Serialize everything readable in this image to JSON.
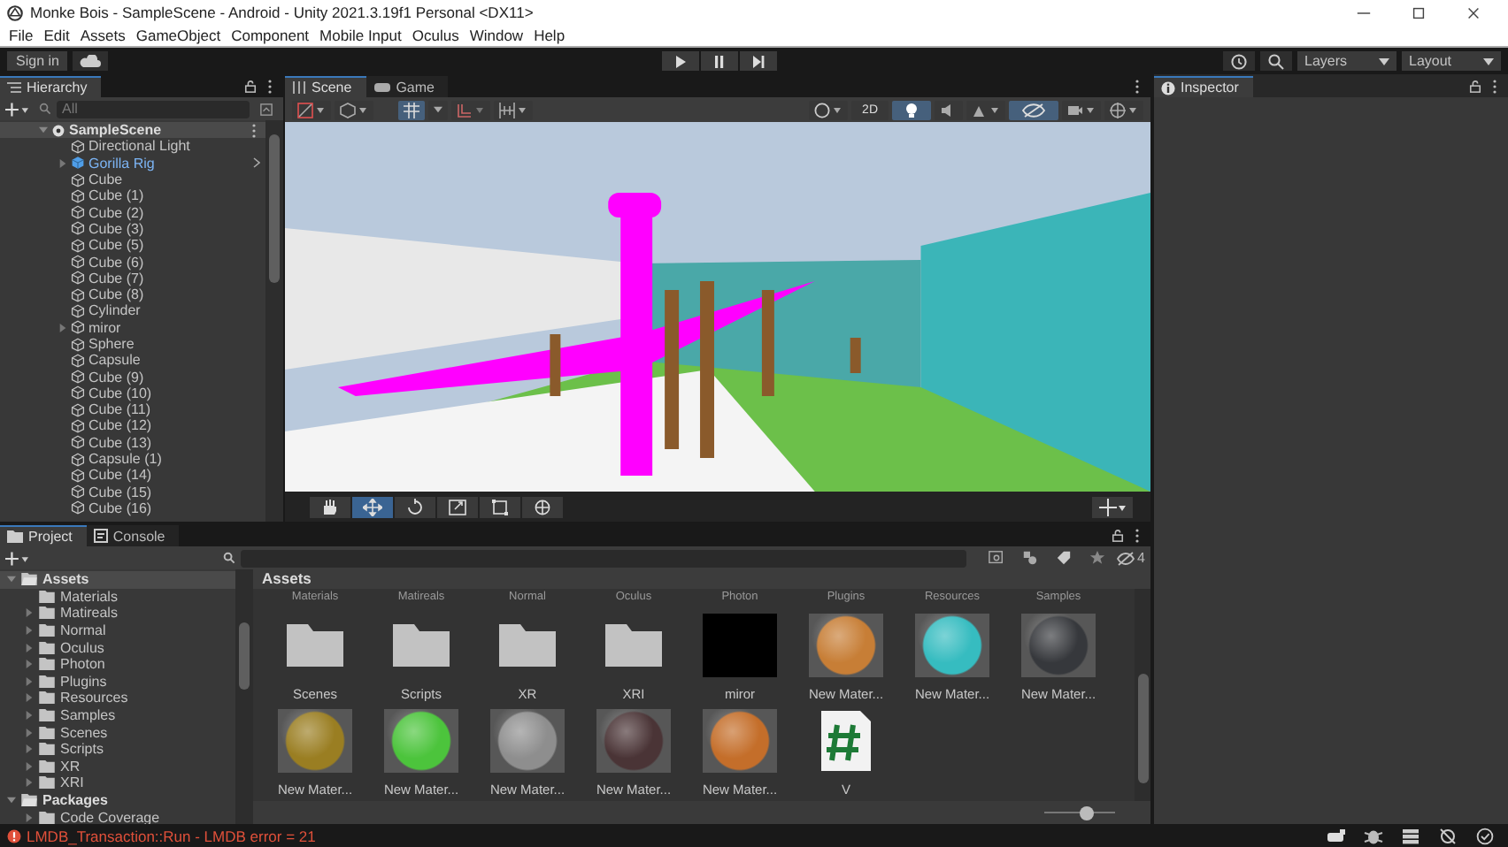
{
  "window": {
    "title": "Monke Bois - SampleScene - Android - Unity 2021.3.19f1 Personal <DX11>"
  },
  "menu": [
    "File",
    "Edit",
    "Assets",
    "GameObject",
    "Component",
    "Mobile Input",
    "Oculus",
    "Window",
    "Help"
  ],
  "toolbar": {
    "sign_in": "Sign in",
    "play": [
      {
        "kind": "play",
        "selected": false
      },
      {
        "kind": "pause",
        "selected": false
      },
      {
        "kind": "step",
        "selected": false
      }
    ],
    "layers": "Layers",
    "layout": "Layout"
  },
  "hierarchy": {
    "title": "Hierarchy",
    "search": {
      "placeholder": "All"
    },
    "root": {
      "label": "SampleScene",
      "expanded": true,
      "children": [
        {
          "label": "Directional Light",
          "kind": "object",
          "expandable": false
        },
        {
          "label": "Gorilla Rig",
          "kind": "prefab",
          "expandable": true
        },
        {
          "label": "Cube",
          "kind": "object",
          "expandable": false
        },
        {
          "label": "Cube (1)",
          "kind": "object",
          "expandable": false
        },
        {
          "label": "Cube (2)",
          "kind": "object",
          "expandable": false
        },
        {
          "label": "Cube (3)",
          "kind": "object",
          "expandable": false
        },
        {
          "label": "Cube (5)",
          "kind": "object",
          "expandable": false
        },
        {
          "label": "Cube (6)",
          "kind": "object",
          "expandable": false
        },
        {
          "label": "Cube (7)",
          "kind": "object",
          "expandable": false
        },
        {
          "label": "Cube (8)",
          "kind": "object",
          "expandable": false
        },
        {
          "label": "Cylinder",
          "kind": "object",
          "expandable": false
        },
        {
          "label": "miror",
          "kind": "object",
          "expandable": true
        },
        {
          "label": "Sphere",
          "kind": "object",
          "expandable": false
        },
        {
          "label": "Capsule",
          "kind": "object",
          "expandable": false
        },
        {
          "label": "Cube (9)",
          "kind": "object",
          "expandable": false
        },
        {
          "label": "Cube (10)",
          "kind": "object",
          "expandable": false
        },
        {
          "label": "Cube (11)",
          "kind": "object",
          "expandable": false
        },
        {
          "label": "Cube (12)",
          "kind": "object",
          "expandable": false
        },
        {
          "label": "Cube (13)",
          "kind": "object",
          "expandable": false
        },
        {
          "label": "Capsule (1)",
          "kind": "object",
          "expandable": false
        },
        {
          "label": "Cube (14)",
          "kind": "object",
          "expandable": false
        },
        {
          "label": "Cube (15)",
          "kind": "object",
          "expandable": false
        },
        {
          "label": "Cube (16)",
          "kind": "object",
          "expandable": false
        }
      ]
    }
  },
  "scene": {
    "tabs": [
      {
        "label": "Scene",
        "kind": "scene",
        "selected": true
      },
      {
        "label": "Game",
        "kind": "game",
        "selected": false
      }
    ],
    "toggle_2d": {
      "label": "2D",
      "selected": false
    },
    "lighting": {
      "selected": true
    },
    "visibility": {
      "selected": true
    },
    "tools": [
      {
        "kind": "hand",
        "selected": false
      },
      {
        "kind": "move",
        "selected": true
      },
      {
        "kind": "rotate",
        "selected": false
      },
      {
        "kind": "scale",
        "selected": false
      },
      {
        "kind": "rect",
        "selected": false
      },
      {
        "kind": "transform",
        "selected": false
      }
    ]
  },
  "inspector": {
    "title": "Inspector"
  },
  "project": {
    "tabs": [
      {
        "label": "Project",
        "kind": "project",
        "selected": true
      },
      {
        "label": "Console",
        "kind": "console",
        "selected": false
      }
    ],
    "hidden_count": "4",
    "tree": [
      {
        "label": "Assets",
        "expanded": true,
        "selected": true,
        "children": [
          {
            "label": "Materials",
            "expandable": false
          },
          {
            "label": "Matireals",
            "expandable": true
          },
          {
            "label": "Normal",
            "expandable": true
          },
          {
            "label": "Oculus",
            "expandable": true
          },
          {
            "label": "Photon",
            "expandable": true
          },
          {
            "label": "Plugins",
            "expandable": true
          },
          {
            "label": "Resources",
            "expandable": true
          },
          {
            "label": "Samples",
            "expandable": true
          },
          {
            "label": "Scenes",
            "expandable": true
          },
          {
            "label": "Scripts",
            "expandable": true
          },
          {
            "label": "XR",
            "expandable": true
          },
          {
            "label": "XRI",
            "expandable": true
          }
        ]
      },
      {
        "label": "Packages",
        "expanded": true,
        "selected": false,
        "children": [
          {
            "label": "Code Coverage",
            "expandable": true
          }
        ]
      }
    ],
    "breadcrumb": "Assets",
    "scrolled_row": [
      "Materials",
      "Matireals",
      "Normal",
      "Oculus",
      "Photon",
      "Plugins",
      "Resources",
      "Samples"
    ],
    "grid": [
      {
        "label": "Scenes",
        "kind": "folder"
      },
      {
        "label": "Scripts",
        "kind": "folder"
      },
      {
        "label": "XR",
        "kind": "folder"
      },
      {
        "label": "XRI",
        "kind": "folder"
      },
      {
        "label": "miror",
        "kind": "texture"
      },
      {
        "label": "New Mater...",
        "kind": "material",
        "color": "#c77e36"
      },
      {
        "label": "New Mater...",
        "kind": "material",
        "color": "#36bcc0"
      },
      {
        "label": "New Mater...",
        "kind": "material",
        "color": "#36383c"
      },
      {
        "label": "New Mater...",
        "kind": "material",
        "color": "#9a7e22"
      },
      {
        "label": "New Mater...",
        "kind": "material",
        "color": "#4cc43c"
      },
      {
        "label": "New Mater...",
        "kind": "material",
        "color": "#8e8e8e"
      },
      {
        "label": "New Mater...",
        "kind": "material",
        "color": "#4a3436"
      },
      {
        "label": "New Mater...",
        "kind": "material",
        "color": "#c46e2a"
      },
      {
        "label": "V",
        "kind": "script"
      }
    ],
    "zoom": {
      "level": 0.6
    }
  },
  "status": {
    "message": "LMDB_Transaction::Run - LMDB error = 21"
  }
}
